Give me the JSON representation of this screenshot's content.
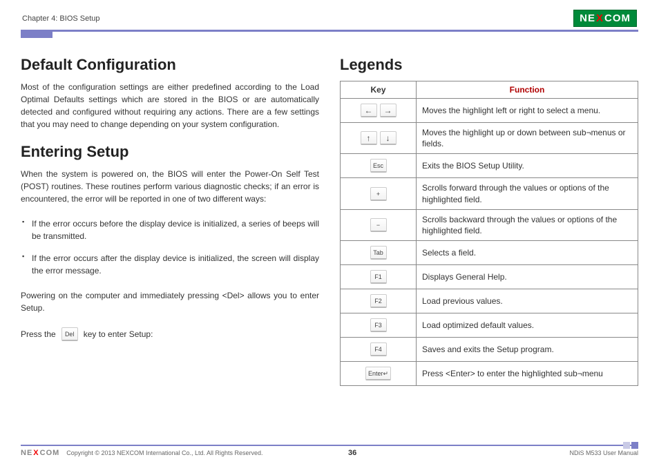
{
  "header": {
    "chapter": "Chapter 4: BIOS Setup",
    "brand_pre": "NE",
    "brand_x": "X",
    "brand_post": "COM"
  },
  "left": {
    "h_default": "Default Configuration",
    "p_default": "Most of the configuration settings are either predefined according to the Load Optimal Defaults settings which are stored in the BIOS or are automatically detected and configured without requiring any actions. There are a few settings that you may need to change depending on your system configuration.",
    "h_entering": "Entering Setup",
    "p_entering": "When the system is powered on, the BIOS will enter the Power-On Self Test (POST) routines. These routines perform various diagnostic checks; if an error is encountered, the error will be reported in one of two different ways:",
    "bullets": [
      "If the error occurs before the display device is initialized, a series of beeps will be transmitted.",
      "If the error occurs after the display device is initialized, the screen will display the error message."
    ],
    "p_del": "Powering on the computer and immediately pressing <Del> allows you to enter Setup.",
    "press_pre": "Press the",
    "press_key": "Del",
    "press_post": "key to enter Setup:"
  },
  "right": {
    "h_legends": "Legends",
    "th_key": "Key",
    "th_func": "Function",
    "rows": [
      {
        "keys": [
          "←",
          "→"
        ],
        "cls": "arrow",
        "func": "Moves the highlight left or right to select a menu."
      },
      {
        "keys": [
          "↑",
          "↓"
        ],
        "cls": "arrow",
        "func": "Moves the highlight up or down between sub¬menus or fields."
      },
      {
        "keys": [
          "Esc"
        ],
        "cls": "",
        "func": "Exits the BIOS Setup Utility."
      },
      {
        "keys": [
          "+"
        ],
        "cls": "",
        "func": "Scrolls forward through the values or options of the highlighted field."
      },
      {
        "keys": [
          "−"
        ],
        "cls": "",
        "func": "Scrolls backward through the values or options of the highlighted field."
      },
      {
        "keys": [
          "Tab"
        ],
        "cls": "",
        "func": "Selects a field."
      },
      {
        "keys": [
          "F1"
        ],
        "cls": "",
        "func": "Displays General Help."
      },
      {
        "keys": [
          "F2"
        ],
        "cls": "",
        "func": "Load previous values."
      },
      {
        "keys": [
          "F3"
        ],
        "cls": "",
        "func": "Load optimized default values."
      },
      {
        "keys": [
          "F4"
        ],
        "cls": "",
        "func": "Saves and exits the Setup program."
      },
      {
        "keys": [
          "Enter↵"
        ],
        "cls": "",
        "func": "Press <Enter> to enter the highlighted sub¬menu"
      }
    ]
  },
  "footer": {
    "copyright": "Copyright © 2013 NEXCOM International Co., Ltd. All Rights Reserved.",
    "page": "36",
    "manual": "NDiS M533 User Manual"
  }
}
